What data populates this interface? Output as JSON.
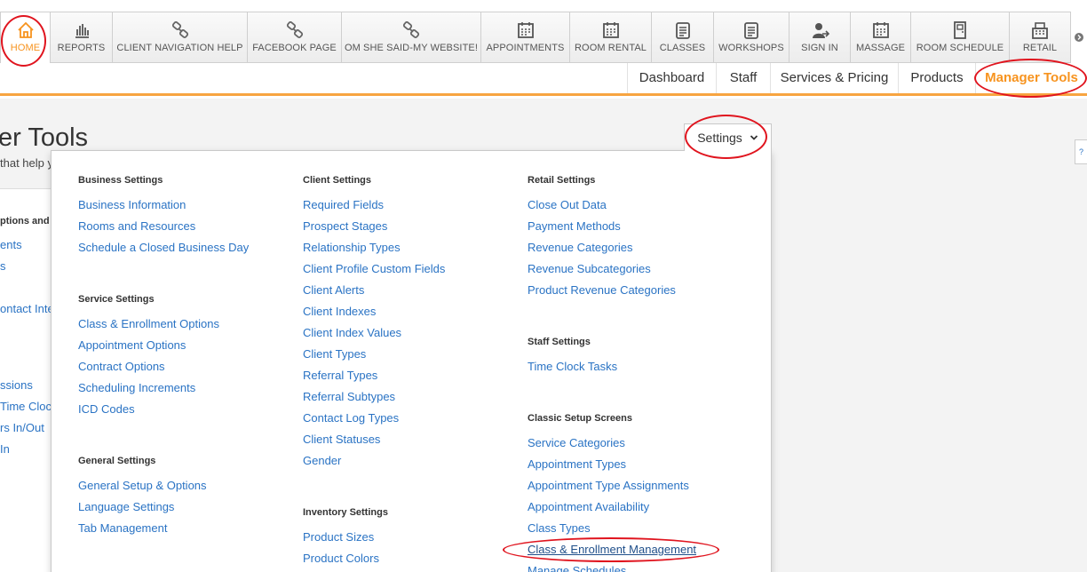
{
  "toolbar": {
    "tabs": [
      {
        "label": "HOME",
        "icon": "home-icon"
      },
      {
        "label": "REPORTS",
        "icon": "bar-chart-icon"
      },
      {
        "label": "CLIENT NAVIGATION HELP",
        "icon": "link-icon"
      },
      {
        "label": "FACEBOOK PAGE",
        "icon": "link-icon"
      },
      {
        "label": "OM SHE SAID-MY WEBSITE!",
        "icon": "link-icon"
      },
      {
        "label": "APPOINTMENTS",
        "icon": "calendar-icon"
      },
      {
        "label": "ROOM RENTAL",
        "icon": "calendar-icon"
      },
      {
        "label": "CLASSES",
        "icon": "clipboard-icon"
      },
      {
        "label": "WORKSHOPS",
        "icon": "clipboard-icon"
      },
      {
        "label": "SIGN IN",
        "icon": "user-signin-icon"
      },
      {
        "label": "MASSAGE",
        "icon": "calendar-icon"
      },
      {
        "label": "ROOM SCHEDULE",
        "icon": "door-icon"
      },
      {
        "label": "RETAIL",
        "icon": "register-icon"
      }
    ],
    "scroll_icon": "chevron-right-icon"
  },
  "subnav": {
    "items": [
      "Dashboard",
      "Staff",
      "Services & Pricing",
      "Products",
      "Manager Tools"
    ],
    "active": "Manager Tools"
  },
  "page": {
    "title": "er Tools",
    "subtitle": "that help y",
    "help_label": "?"
  },
  "left_panel": {
    "heading": "ptions and M",
    "items": [
      "ents",
      "s",
      "ontact Inte",
      "ssions",
      "Time Clock",
      "rs In/Out",
      "In"
    ]
  },
  "settings": {
    "button_label": "Settings",
    "columns": [
      {
        "sections": [
          {
            "title": "Business Settings",
            "links": [
              "Business Information",
              "Rooms and Resources",
              "Schedule a Closed Business Day"
            ]
          },
          {
            "title": "Service Settings",
            "links": [
              "Class & Enrollment Options",
              "Appointment Options",
              "Contract Options",
              "Scheduling Increments",
              "ICD Codes"
            ]
          },
          {
            "title": "General Settings",
            "links": [
              "General Setup & Options",
              "Language Settings",
              "Tab Management"
            ]
          }
        ]
      },
      {
        "sections": [
          {
            "title": "Client Settings",
            "links": [
              "Required Fields",
              "Prospect Stages",
              "Relationship Types",
              "Client Profile Custom Fields",
              "Client Alerts",
              "Client Indexes",
              "Client Index Values",
              "Client Types",
              "Referral Types",
              "Referral Subtypes",
              "Contact Log Types",
              "Client Statuses",
              "Gender"
            ]
          },
          {
            "title": "Inventory Settings",
            "links": [
              "Product Sizes",
              "Product Colors"
            ]
          }
        ]
      },
      {
        "sections": [
          {
            "title": "Retail Settings",
            "links": [
              "Close Out Data",
              "Payment Methods",
              "Revenue Categories",
              "Revenue Subcategories",
              "Product Revenue Categories"
            ]
          },
          {
            "title": "Staff Settings",
            "links": [
              "Time Clock Tasks"
            ]
          },
          {
            "title": "Classic Setup Screens",
            "links": [
              "Service Categories",
              "Appointment Types",
              "Appointment Type Assignments",
              "Appointment Availability",
              "Class Types",
              "Class & Enrollment Management",
              "Manage Schedules"
            ]
          }
        ]
      }
    ]
  },
  "colors": {
    "accent_orange": "#f7931e",
    "link_blue": "#2a73c4",
    "annotation_red": "#e0141e"
  }
}
